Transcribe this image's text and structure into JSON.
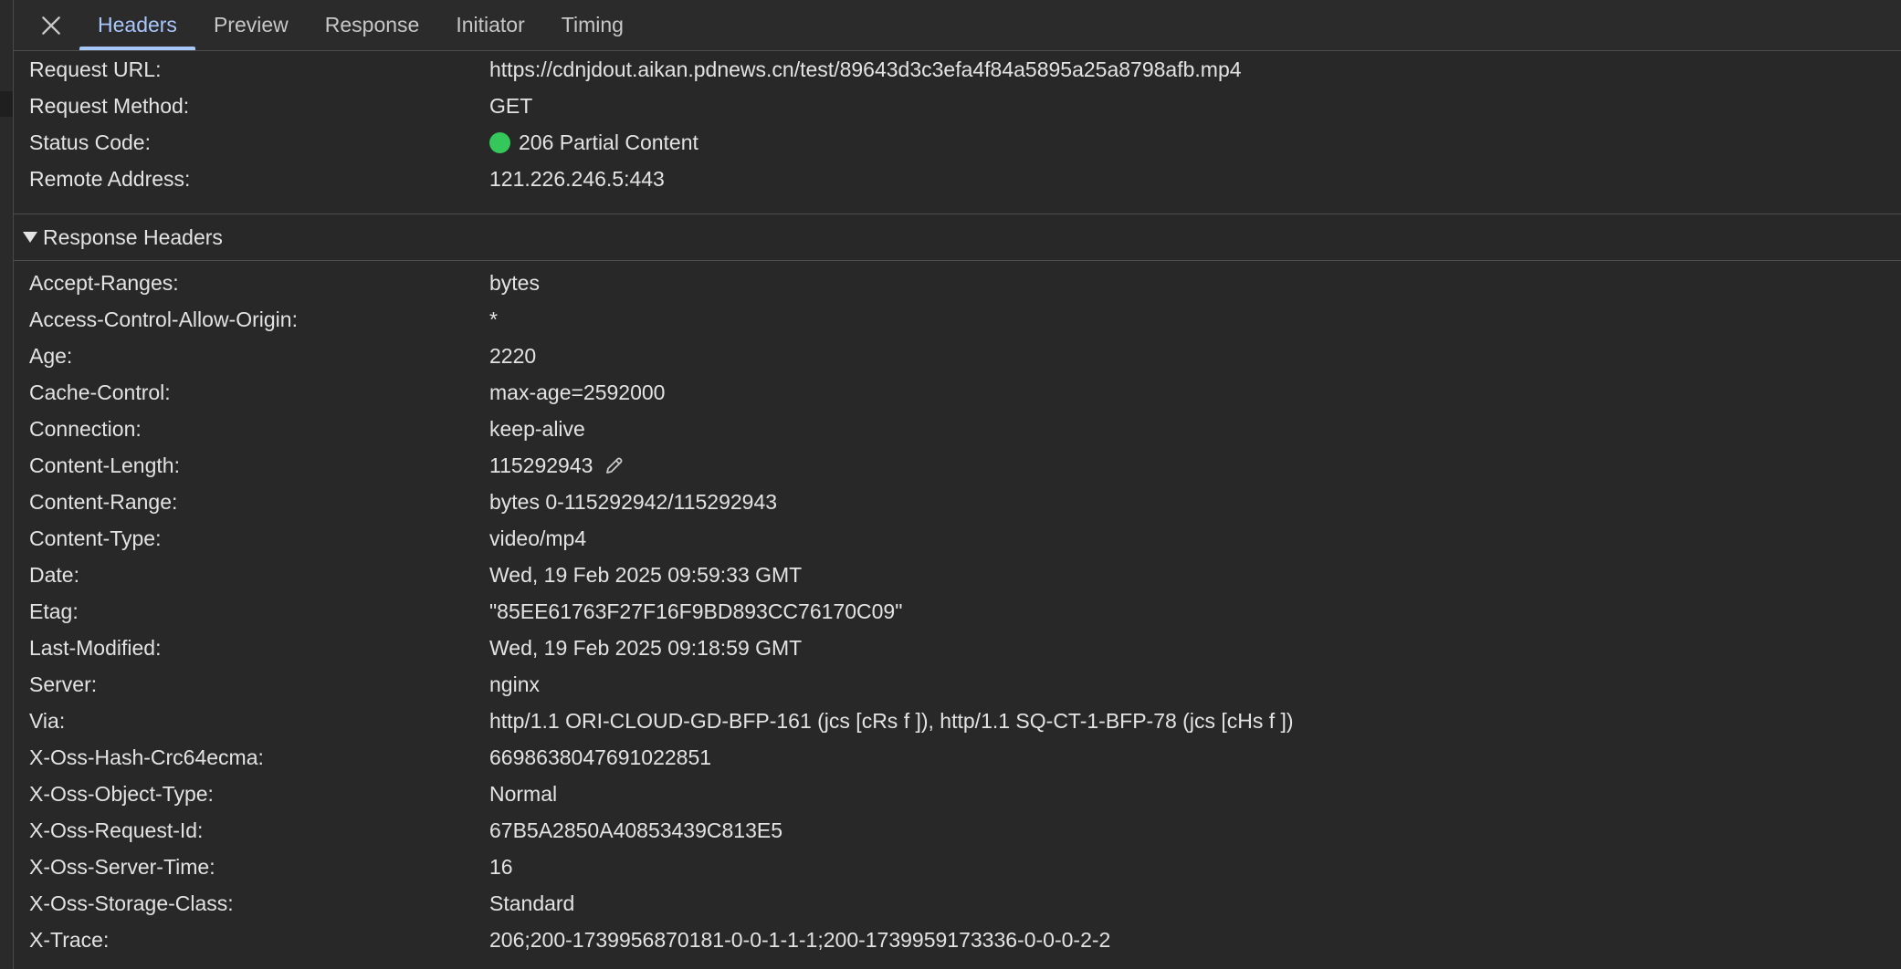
{
  "tabs": [
    {
      "label": "Headers",
      "active": true
    },
    {
      "label": "Preview",
      "active": false
    },
    {
      "label": "Response",
      "active": false
    },
    {
      "label": "Initiator",
      "active": false
    },
    {
      "label": "Timing",
      "active": false
    }
  ],
  "general": {
    "request_url": {
      "name": "Request URL:",
      "value": "https://cdnjdout.aikan.pdnews.cn/test/89643d3c3efa4f84a5895a25a8798afb.mp4"
    },
    "request_method": {
      "name": "Request Method:",
      "value": "GET"
    },
    "status_code": {
      "name": "Status Code:",
      "value": "206 Partial Content",
      "status_color": "#34c759"
    },
    "remote_address": {
      "name": "Remote Address:",
      "value": "121.226.246.5:443"
    }
  },
  "response_headers": {
    "title": "Response Headers",
    "items": [
      {
        "name": "Accept-Ranges:",
        "value": "bytes"
      },
      {
        "name": "Access-Control-Allow-Origin:",
        "value": "*"
      },
      {
        "name": "Age:",
        "value": "2220"
      },
      {
        "name": "Cache-Control:",
        "value": "max-age=2592000"
      },
      {
        "name": "Connection:",
        "value": "keep-alive"
      },
      {
        "name": "Content-Length:",
        "value": "115292943"
      },
      {
        "name": "Content-Range:",
        "value": "bytes 0-115292942/115292943"
      },
      {
        "name": "Content-Type:",
        "value": "video/mp4"
      },
      {
        "name": "Date:",
        "value": "Wed, 19 Feb 2025 09:59:33 GMT"
      },
      {
        "name": "Etag:",
        "value": "\"85EE61763F27F16F9BD893CC76170C09\""
      },
      {
        "name": "Last-Modified:",
        "value": "Wed, 19 Feb 2025 09:18:59 GMT"
      },
      {
        "name": "Server:",
        "value": "nginx"
      },
      {
        "name": "Via:",
        "value": "http/1.1 ORI-CLOUD-GD-BFP-161 (jcs [cRs f ]), http/1.1 SQ-CT-1-BFP-78 (jcs [cHs f ])"
      },
      {
        "name": "X-Oss-Hash-Crc64ecma:",
        "value": "6698638047691022851"
      },
      {
        "name": "X-Oss-Object-Type:",
        "value": "Normal"
      },
      {
        "name": "X-Oss-Request-Id:",
        "value": "67B5A2850A40853439C813E5"
      },
      {
        "name": "X-Oss-Server-Time:",
        "value": "16"
      },
      {
        "name": "X-Oss-Storage-Class:",
        "value": "Standard"
      },
      {
        "name": "X-Trace:",
        "value": "206;200-1739956870181-0-0-1-1-1;200-1739959173336-0-0-0-2-2"
      }
    ]
  },
  "icons": {
    "close": "close-icon",
    "edit": "pencil-icon",
    "status": "status-dot-icon"
  },
  "colors": {
    "accent": "#a8c7fa",
    "status_ok": "#34c759",
    "background": "#282828"
  }
}
